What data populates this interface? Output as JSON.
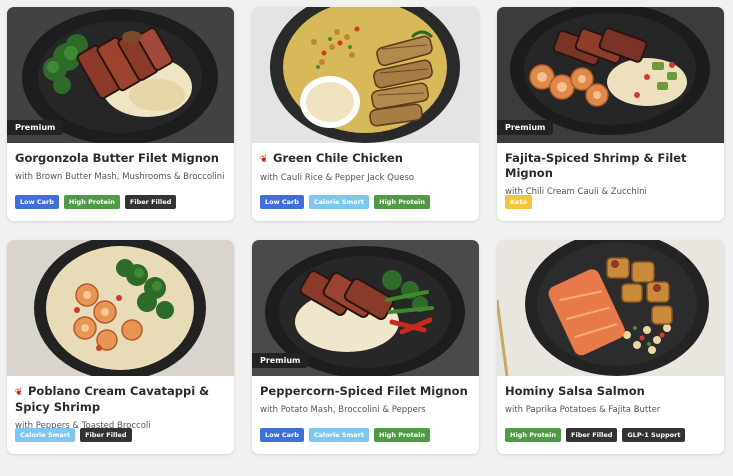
{
  "meals": [
    {
      "title": "Gorgonzola Butter Filet Mignon",
      "subtitle": "with Brown Butter Mash, Mushrooms & Broccolini",
      "premium": "Premium",
      "spicy": false,
      "tags": [
        {
          "label": "Low Carb",
          "color": "#3f6fd8"
        },
        {
          "label": "High Protein",
          "color": "#4f9a45"
        },
        {
          "label": "Fiber Filled",
          "color": "#333333"
        }
      ]
    },
    {
      "title": "Green Chile Chicken",
      "subtitle": "with Cauli Rice & Pepper Jack Queso",
      "premium": "",
      "spicy": true,
      "tags": [
        {
          "label": "Low Carb",
          "color": "#3f6fd8"
        },
        {
          "label": "Calorie Smart",
          "color": "#7ec8f0"
        },
        {
          "label": "High Protein",
          "color": "#4f9a45"
        }
      ]
    },
    {
      "title": "Fajita-Spiced Shrimp & Filet Mignon",
      "subtitle": "with Chili Cream Cauli & Zucchini",
      "premium": "Premium",
      "spicy": false,
      "tags": [
        {
          "label": "Keto",
          "color": "#f2c43d"
        }
      ]
    },
    {
      "title": "Poblano Cream Cavatappi & Spicy Shrimp",
      "subtitle": "with Peppers & Toasted Broccoli",
      "premium": "",
      "spicy": true,
      "tags": [
        {
          "label": "Calorie Smart",
          "color": "#7ec8f0"
        },
        {
          "label": "Fiber Filled",
          "color": "#333333"
        }
      ]
    },
    {
      "title": "Peppercorn-Spiced Filet Mignon",
      "subtitle": "with Potato Mash, Broccolini & Peppers",
      "premium": "Premium",
      "spicy": false,
      "tags": [
        {
          "label": "Low Carb",
          "color": "#3f6fd8"
        },
        {
          "label": "Calorie Smart",
          "color": "#7ec8f0"
        },
        {
          "label": "High Protein",
          "color": "#4f9a45"
        }
      ]
    },
    {
      "title": "Hominy Salsa Salmon",
      "subtitle": "with Paprika Potatoes & Fajita Butter",
      "premium": "",
      "spicy": false,
      "tags": [
        {
          "label": "High Protein",
          "color": "#4f9a45"
        },
        {
          "label": "Fiber Filled",
          "color": "#333333"
        },
        {
          "label": "GLP-1 Support",
          "color": "#333333"
        }
      ]
    }
  ]
}
